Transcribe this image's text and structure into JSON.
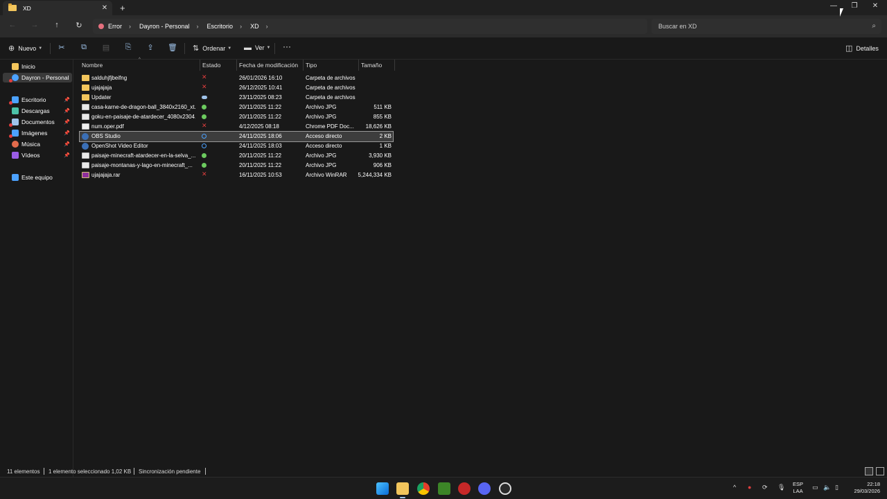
{
  "window": {
    "tab_title": "XD",
    "tab_close": "✕",
    "new_tab": "+",
    "minimize": "—",
    "maximize": "❐",
    "close": "✕"
  },
  "nav": {
    "back": "←",
    "forward": "→",
    "up": "↑",
    "refresh": "↻",
    "breadcrumbs": [
      "Error",
      "Dayron - Personal",
      "Escritorio",
      "XD"
    ],
    "separator": "›",
    "search_placeholder": "Buscar en XD",
    "search_icon": "⌕"
  },
  "toolbar": {
    "new_label": "Nuevo",
    "sort_label": "Ordenar",
    "view_label": "Ver",
    "more_label": "···",
    "details_label": "Detalles"
  },
  "sidebar": {
    "items": [
      {
        "label": "Inicio",
        "icon": "home-icon",
        "color": "#f2c55c"
      },
      {
        "label": "Dayron - Personal",
        "icon": "onedrive-icon",
        "color": "#4ca2ff"
      },
      {
        "label": "Escritorio",
        "icon": "desktop-icon",
        "color": "#4ca2ff"
      },
      {
        "label": "Descargas",
        "icon": "downloads-icon",
        "color": "#4cc2a8"
      },
      {
        "label": "Documentos",
        "icon": "documents-icon",
        "color": "#9fc3ea"
      },
      {
        "label": "Imágenes",
        "icon": "pictures-icon",
        "color": "#4ca2ff"
      },
      {
        "label": "Música",
        "icon": "music-icon",
        "color": "#e36b4c"
      },
      {
        "label": "Vídeos",
        "icon": "videos-icon",
        "color": "#9b5de5"
      },
      {
        "label": "Este equipo",
        "icon": "computer-icon",
        "color": "#4ca2ff"
      }
    ],
    "pin": "📌"
  },
  "columns": {
    "name": "Nombre",
    "status": "Estado",
    "modified": "Fecha de modificación",
    "type": "Tipo",
    "size": "Tamaño"
  },
  "files": [
    {
      "name": "salduhjfjbeifng",
      "status": "error",
      "modified": "26/01/2026 16:10",
      "type": "Carpeta de archivos",
      "size": "",
      "icon": "folder"
    },
    {
      "name": "ujajajaja",
      "status": "error",
      "modified": "26/12/2025 10:41",
      "type": "Carpeta de archivos",
      "size": "",
      "icon": "folder"
    },
    {
      "name": "Updater",
      "status": "cloud",
      "modified": "23/11/2025 08:23",
      "type": "Carpeta de archivos",
      "size": "",
      "icon": "folder"
    },
    {
      "name": "casa-karne-de-dragon-ball_3840x2160_xt...",
      "status": "ok",
      "modified": "20/11/2025 11:22",
      "type": "Archivo JPG",
      "size": "511 KB",
      "icon": "jpg"
    },
    {
      "name": "goku-en-paisaje-de-atardecer_4080x2304...",
      "status": "ok",
      "modified": "20/11/2025 11:22",
      "type": "Archivo JPG",
      "size": "855 KB",
      "icon": "jpg"
    },
    {
      "name": "num.oper.pdf",
      "status": "error",
      "modified": "4/12/2025 08:18",
      "type": "Chrome PDF Doc...",
      "size": "18,626 KB",
      "icon": "pdf"
    },
    {
      "name": "OBS Studio",
      "status": "sync",
      "modified": "24/11/2025 18:06",
      "type": "Acceso directo",
      "size": "2 KB",
      "icon": "lnk"
    },
    {
      "name": "OpenShot Video Editor",
      "status": "sync",
      "modified": "24/11/2025 18:03",
      "type": "Acceso directo",
      "size": "1 KB",
      "icon": "lnk"
    },
    {
      "name": "paisaje-minecraft-atardecer-en-la-selva_...",
      "status": "ok",
      "modified": "20/11/2025 11:22",
      "type": "Archivo JPG",
      "size": "3,930 KB",
      "icon": "jpg"
    },
    {
      "name": "paisaje-montanas-y-lago-en-minecraft_...",
      "status": "ok",
      "modified": "20/11/2025 11:22",
      "type": "Archivo JPG",
      "size": "906 KB",
      "icon": "jpg"
    },
    {
      "name": "ujajajaja.rar",
      "status": "error",
      "modified": "16/11/2025 10:53",
      "type": "Archivo WinRAR",
      "size": "5,244,334 KB",
      "icon": "rar"
    }
  ],
  "status": {
    "count": "11 elementos",
    "selected": "1 elemento seleccionado  1,02 KB",
    "sync": "Sincronización pendiente"
  },
  "taskbar": {
    "lang_top": "ESP",
    "lang_bottom": "LAA",
    "time": "22:18",
    "date": "29/03/2026",
    "chevron": "^"
  },
  "colors": {
    "accent": "#4ca2ff",
    "error": "#e03e3e",
    "ok": "#6ccb5f"
  }
}
